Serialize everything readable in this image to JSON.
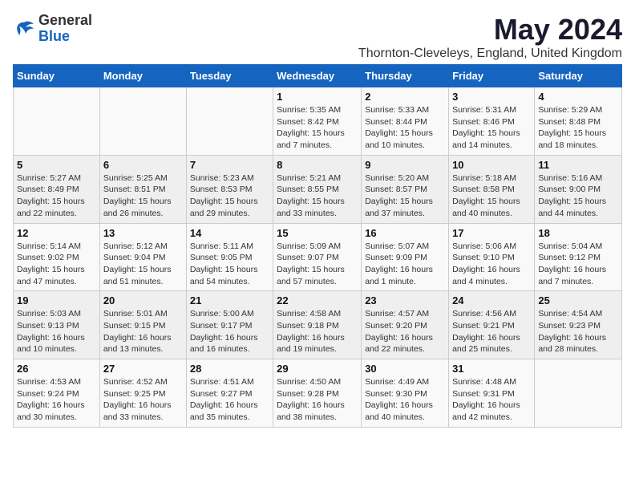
{
  "logo": {
    "general": "General",
    "blue": "Blue"
  },
  "title": "May 2024",
  "location": "Thornton-Cleveleys, England, United Kingdom",
  "days_header": [
    "Sunday",
    "Monday",
    "Tuesday",
    "Wednesday",
    "Thursday",
    "Friday",
    "Saturday"
  ],
  "weeks": [
    [
      {
        "day": "",
        "info": ""
      },
      {
        "day": "",
        "info": ""
      },
      {
        "day": "",
        "info": ""
      },
      {
        "day": "1",
        "info": "Sunrise: 5:35 AM\nSunset: 8:42 PM\nDaylight: 15 hours\nand 7 minutes."
      },
      {
        "day": "2",
        "info": "Sunrise: 5:33 AM\nSunset: 8:44 PM\nDaylight: 15 hours\nand 10 minutes."
      },
      {
        "day": "3",
        "info": "Sunrise: 5:31 AM\nSunset: 8:46 PM\nDaylight: 15 hours\nand 14 minutes."
      },
      {
        "day": "4",
        "info": "Sunrise: 5:29 AM\nSunset: 8:48 PM\nDaylight: 15 hours\nand 18 minutes."
      }
    ],
    [
      {
        "day": "5",
        "info": "Sunrise: 5:27 AM\nSunset: 8:49 PM\nDaylight: 15 hours\nand 22 minutes."
      },
      {
        "day": "6",
        "info": "Sunrise: 5:25 AM\nSunset: 8:51 PM\nDaylight: 15 hours\nand 26 minutes."
      },
      {
        "day": "7",
        "info": "Sunrise: 5:23 AM\nSunset: 8:53 PM\nDaylight: 15 hours\nand 29 minutes."
      },
      {
        "day": "8",
        "info": "Sunrise: 5:21 AM\nSunset: 8:55 PM\nDaylight: 15 hours\nand 33 minutes."
      },
      {
        "day": "9",
        "info": "Sunrise: 5:20 AM\nSunset: 8:57 PM\nDaylight: 15 hours\nand 37 minutes."
      },
      {
        "day": "10",
        "info": "Sunrise: 5:18 AM\nSunset: 8:58 PM\nDaylight: 15 hours\nand 40 minutes."
      },
      {
        "day": "11",
        "info": "Sunrise: 5:16 AM\nSunset: 9:00 PM\nDaylight: 15 hours\nand 44 minutes."
      }
    ],
    [
      {
        "day": "12",
        "info": "Sunrise: 5:14 AM\nSunset: 9:02 PM\nDaylight: 15 hours\nand 47 minutes."
      },
      {
        "day": "13",
        "info": "Sunrise: 5:12 AM\nSunset: 9:04 PM\nDaylight: 15 hours\nand 51 minutes."
      },
      {
        "day": "14",
        "info": "Sunrise: 5:11 AM\nSunset: 9:05 PM\nDaylight: 15 hours\nand 54 minutes."
      },
      {
        "day": "15",
        "info": "Sunrise: 5:09 AM\nSunset: 9:07 PM\nDaylight: 15 hours\nand 57 minutes."
      },
      {
        "day": "16",
        "info": "Sunrise: 5:07 AM\nSunset: 9:09 PM\nDaylight: 16 hours\nand 1 minute."
      },
      {
        "day": "17",
        "info": "Sunrise: 5:06 AM\nSunset: 9:10 PM\nDaylight: 16 hours\nand 4 minutes."
      },
      {
        "day": "18",
        "info": "Sunrise: 5:04 AM\nSunset: 9:12 PM\nDaylight: 16 hours\nand 7 minutes."
      }
    ],
    [
      {
        "day": "19",
        "info": "Sunrise: 5:03 AM\nSunset: 9:13 PM\nDaylight: 16 hours\nand 10 minutes."
      },
      {
        "day": "20",
        "info": "Sunrise: 5:01 AM\nSunset: 9:15 PM\nDaylight: 16 hours\nand 13 minutes."
      },
      {
        "day": "21",
        "info": "Sunrise: 5:00 AM\nSunset: 9:17 PM\nDaylight: 16 hours\nand 16 minutes."
      },
      {
        "day": "22",
        "info": "Sunrise: 4:58 AM\nSunset: 9:18 PM\nDaylight: 16 hours\nand 19 minutes."
      },
      {
        "day": "23",
        "info": "Sunrise: 4:57 AM\nSunset: 9:20 PM\nDaylight: 16 hours\nand 22 minutes."
      },
      {
        "day": "24",
        "info": "Sunrise: 4:56 AM\nSunset: 9:21 PM\nDaylight: 16 hours\nand 25 minutes."
      },
      {
        "day": "25",
        "info": "Sunrise: 4:54 AM\nSunset: 9:23 PM\nDaylight: 16 hours\nand 28 minutes."
      }
    ],
    [
      {
        "day": "26",
        "info": "Sunrise: 4:53 AM\nSunset: 9:24 PM\nDaylight: 16 hours\nand 30 minutes."
      },
      {
        "day": "27",
        "info": "Sunrise: 4:52 AM\nSunset: 9:25 PM\nDaylight: 16 hours\nand 33 minutes."
      },
      {
        "day": "28",
        "info": "Sunrise: 4:51 AM\nSunset: 9:27 PM\nDaylight: 16 hours\nand 35 minutes."
      },
      {
        "day": "29",
        "info": "Sunrise: 4:50 AM\nSunset: 9:28 PM\nDaylight: 16 hours\nand 38 minutes."
      },
      {
        "day": "30",
        "info": "Sunrise: 4:49 AM\nSunset: 9:30 PM\nDaylight: 16 hours\nand 40 minutes."
      },
      {
        "day": "31",
        "info": "Sunrise: 4:48 AM\nSunset: 9:31 PM\nDaylight: 16 hours\nand 42 minutes."
      },
      {
        "day": "",
        "info": ""
      }
    ]
  ]
}
